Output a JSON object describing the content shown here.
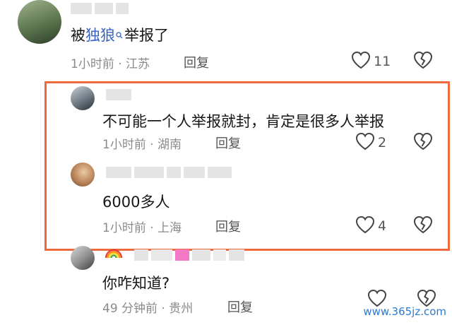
{
  "comments": [
    {
      "text_prefix": "被",
      "text_keyword": "独狼",
      "text_suffix": "举报了",
      "meta": "1小时前 · 江苏",
      "reply_label": "回复",
      "likes": "11"
    },
    {
      "text": "不可能一个人举报就封，肯定是很多人举报",
      "meta": "1小时前 · 湖南",
      "reply_label": "回复",
      "likes": "2"
    },
    {
      "text": "6000多人",
      "meta": "1小时前 · 上海",
      "reply_label": "回复",
      "likes": "4"
    },
    {
      "text": "你咋知道?",
      "meta": "49 分钟前 · 贵州",
      "reply_label": "回复",
      "likes": ""
    }
  ],
  "highlight_color": "#ec6a3b",
  "keyword_color": "#3a64c2",
  "watermark": "www.365jz.com",
  "icons": [
    "heart-icon",
    "broken-heart-icon",
    "search-icon",
    "rainbow-icon"
  ]
}
